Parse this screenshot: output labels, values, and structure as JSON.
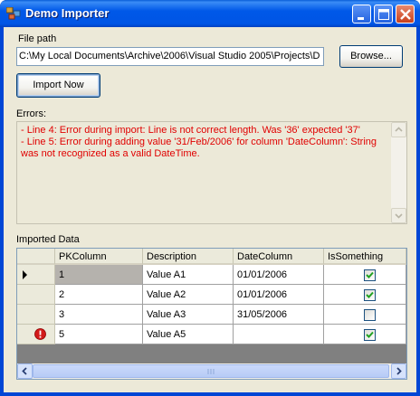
{
  "window": {
    "title": "Demo Importer",
    "icons": [
      "app-icon",
      "minimize-icon",
      "maximize-icon",
      "close-icon"
    ]
  },
  "file_path": {
    "label": "File path",
    "value": "C:\\My Local Documents\\Archive\\2006\\Visual Studio 2005\\Projects\\D",
    "browse_label": "Browse..."
  },
  "import_button": {
    "label": "Import Now"
  },
  "errors": {
    "label": "Errors:",
    "lines": [
      " - Line 4: Error during import: Line is not correct length. Was '36' expected '37'",
      " - Line 5: Error during adding value '31/Feb/2006' for column 'DateColumn': String was not recognized as a valid DateTime."
    ]
  },
  "grid": {
    "label": "Imported Data",
    "columns": [
      "PKColumn",
      "Description",
      "DateColumn",
      "IsSomething"
    ],
    "rows": [
      {
        "pk": "1",
        "description": "Value A1",
        "date": "01/01/2006",
        "checked": true,
        "indicator": "current-row-arrow"
      },
      {
        "pk": "2",
        "description": "Value A2",
        "date": "01/01/2006",
        "checked": true,
        "indicator": ""
      },
      {
        "pk": "3",
        "description": "Value A3",
        "date": "31/05/2006",
        "checked": false,
        "indicator": ""
      },
      {
        "pk": "5",
        "description": "Value A5",
        "date": "",
        "checked": true,
        "indicator": "error-icon"
      }
    ]
  },
  "colors": {
    "error_text": "#e00000",
    "titlebar": "#0055e5",
    "selection": "#b5b2ad",
    "check": "#21a121"
  }
}
